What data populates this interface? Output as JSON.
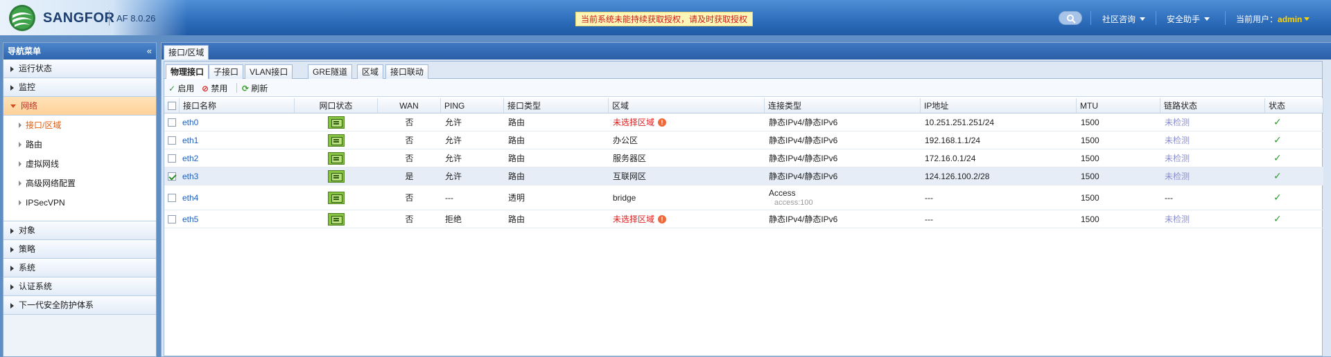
{
  "header": {
    "brand": "SANGFOR",
    "version": "AF 8.0.26",
    "license_notice": "当前系统未能持续获取授权，请及时获取授权",
    "menus": [
      "社区咨询",
      "安全助手"
    ],
    "user_label": "当前用户：",
    "user_name": "admin"
  },
  "sidebar": {
    "title": "导航菜单",
    "collapse_glyph": "«",
    "groups_top": [
      "运行状态",
      "监控"
    ],
    "active_group": "网络",
    "sub_items": [
      "接口/区域",
      "路由",
      "虚拟网线",
      "高级网络配置",
      "IPSecVPN"
    ],
    "groups_bottom": [
      "对象",
      "策略",
      "系统",
      "认证系统",
      "下一代安全防护体系"
    ]
  },
  "page_tab": "接口/区域",
  "sub_tabs": [
    "物理接口",
    "子接口",
    "VLAN接口",
    "GRE隧道",
    "区域",
    "接口联动"
  ],
  "toolbar": {
    "enable": "启用",
    "disable": "禁用",
    "refresh": "刷新"
  },
  "table": {
    "columns": [
      "接口名称",
      "网口状态",
      "WAN",
      "PING",
      "接口类型",
      "区域",
      "连接类型",
      "IP地址",
      "MTU",
      "链路状态",
      "状态"
    ],
    "rows": [
      {
        "checked": false,
        "name": "eth0",
        "wan": "否",
        "ping": "允许",
        "type": "路由",
        "zone": "未选择区域",
        "zone_warn": true,
        "conn": "静态IPv4/静态IPv6",
        "conn_sub": "",
        "ip": "10.251.251.251/24",
        "mtu": "1500",
        "link": "未检测",
        "link_gray": true
      },
      {
        "checked": false,
        "name": "eth1",
        "wan": "否",
        "ping": "允许",
        "type": "路由",
        "zone": "办公区",
        "zone_warn": false,
        "conn": "静态IPv4/静态IPv6",
        "conn_sub": "",
        "ip": "192.168.1.1/24",
        "mtu": "1500",
        "link": "未检测",
        "link_gray": true
      },
      {
        "checked": false,
        "name": "eth2",
        "wan": "否",
        "ping": "允许",
        "type": "路由",
        "zone": "服务器区",
        "zone_warn": false,
        "conn": "静态IPv4/静态IPv6",
        "conn_sub": "",
        "ip": "172.16.0.1/24",
        "mtu": "1500",
        "link": "未检测",
        "link_gray": true
      },
      {
        "checked": true,
        "name": "eth3",
        "wan": "是",
        "ping": "允许",
        "type": "路由",
        "zone": "互联网区",
        "zone_warn": false,
        "conn": "静态IPv4/静态IPv6",
        "conn_sub": "",
        "ip": "124.126.100.2/28",
        "mtu": "1500",
        "link": "未检测",
        "link_gray": true
      },
      {
        "checked": false,
        "name": "eth4",
        "wan": "否",
        "ping": "---",
        "type": "透明",
        "zone": "bridge",
        "zone_warn": false,
        "conn": "Access",
        "conn_sub": "access:100",
        "ip": "---",
        "mtu": "1500",
        "link": "---",
        "link_gray": false
      },
      {
        "checked": false,
        "name": "eth5",
        "wan": "否",
        "ping": "拒绝",
        "type": "路由",
        "zone": "未选择区域",
        "zone_warn": true,
        "conn": "静态IPv4/静态IPv6",
        "conn_sub": "",
        "ip": "---",
        "mtu": "1500",
        "link": "未检测",
        "link_gray": true
      }
    ]
  },
  "colors": {
    "accent_orange": "#e25b0e",
    "warn_red": "#e02020",
    "link_blue": "#1f5fbf",
    "ok_green": "#2e9a2e"
  }
}
